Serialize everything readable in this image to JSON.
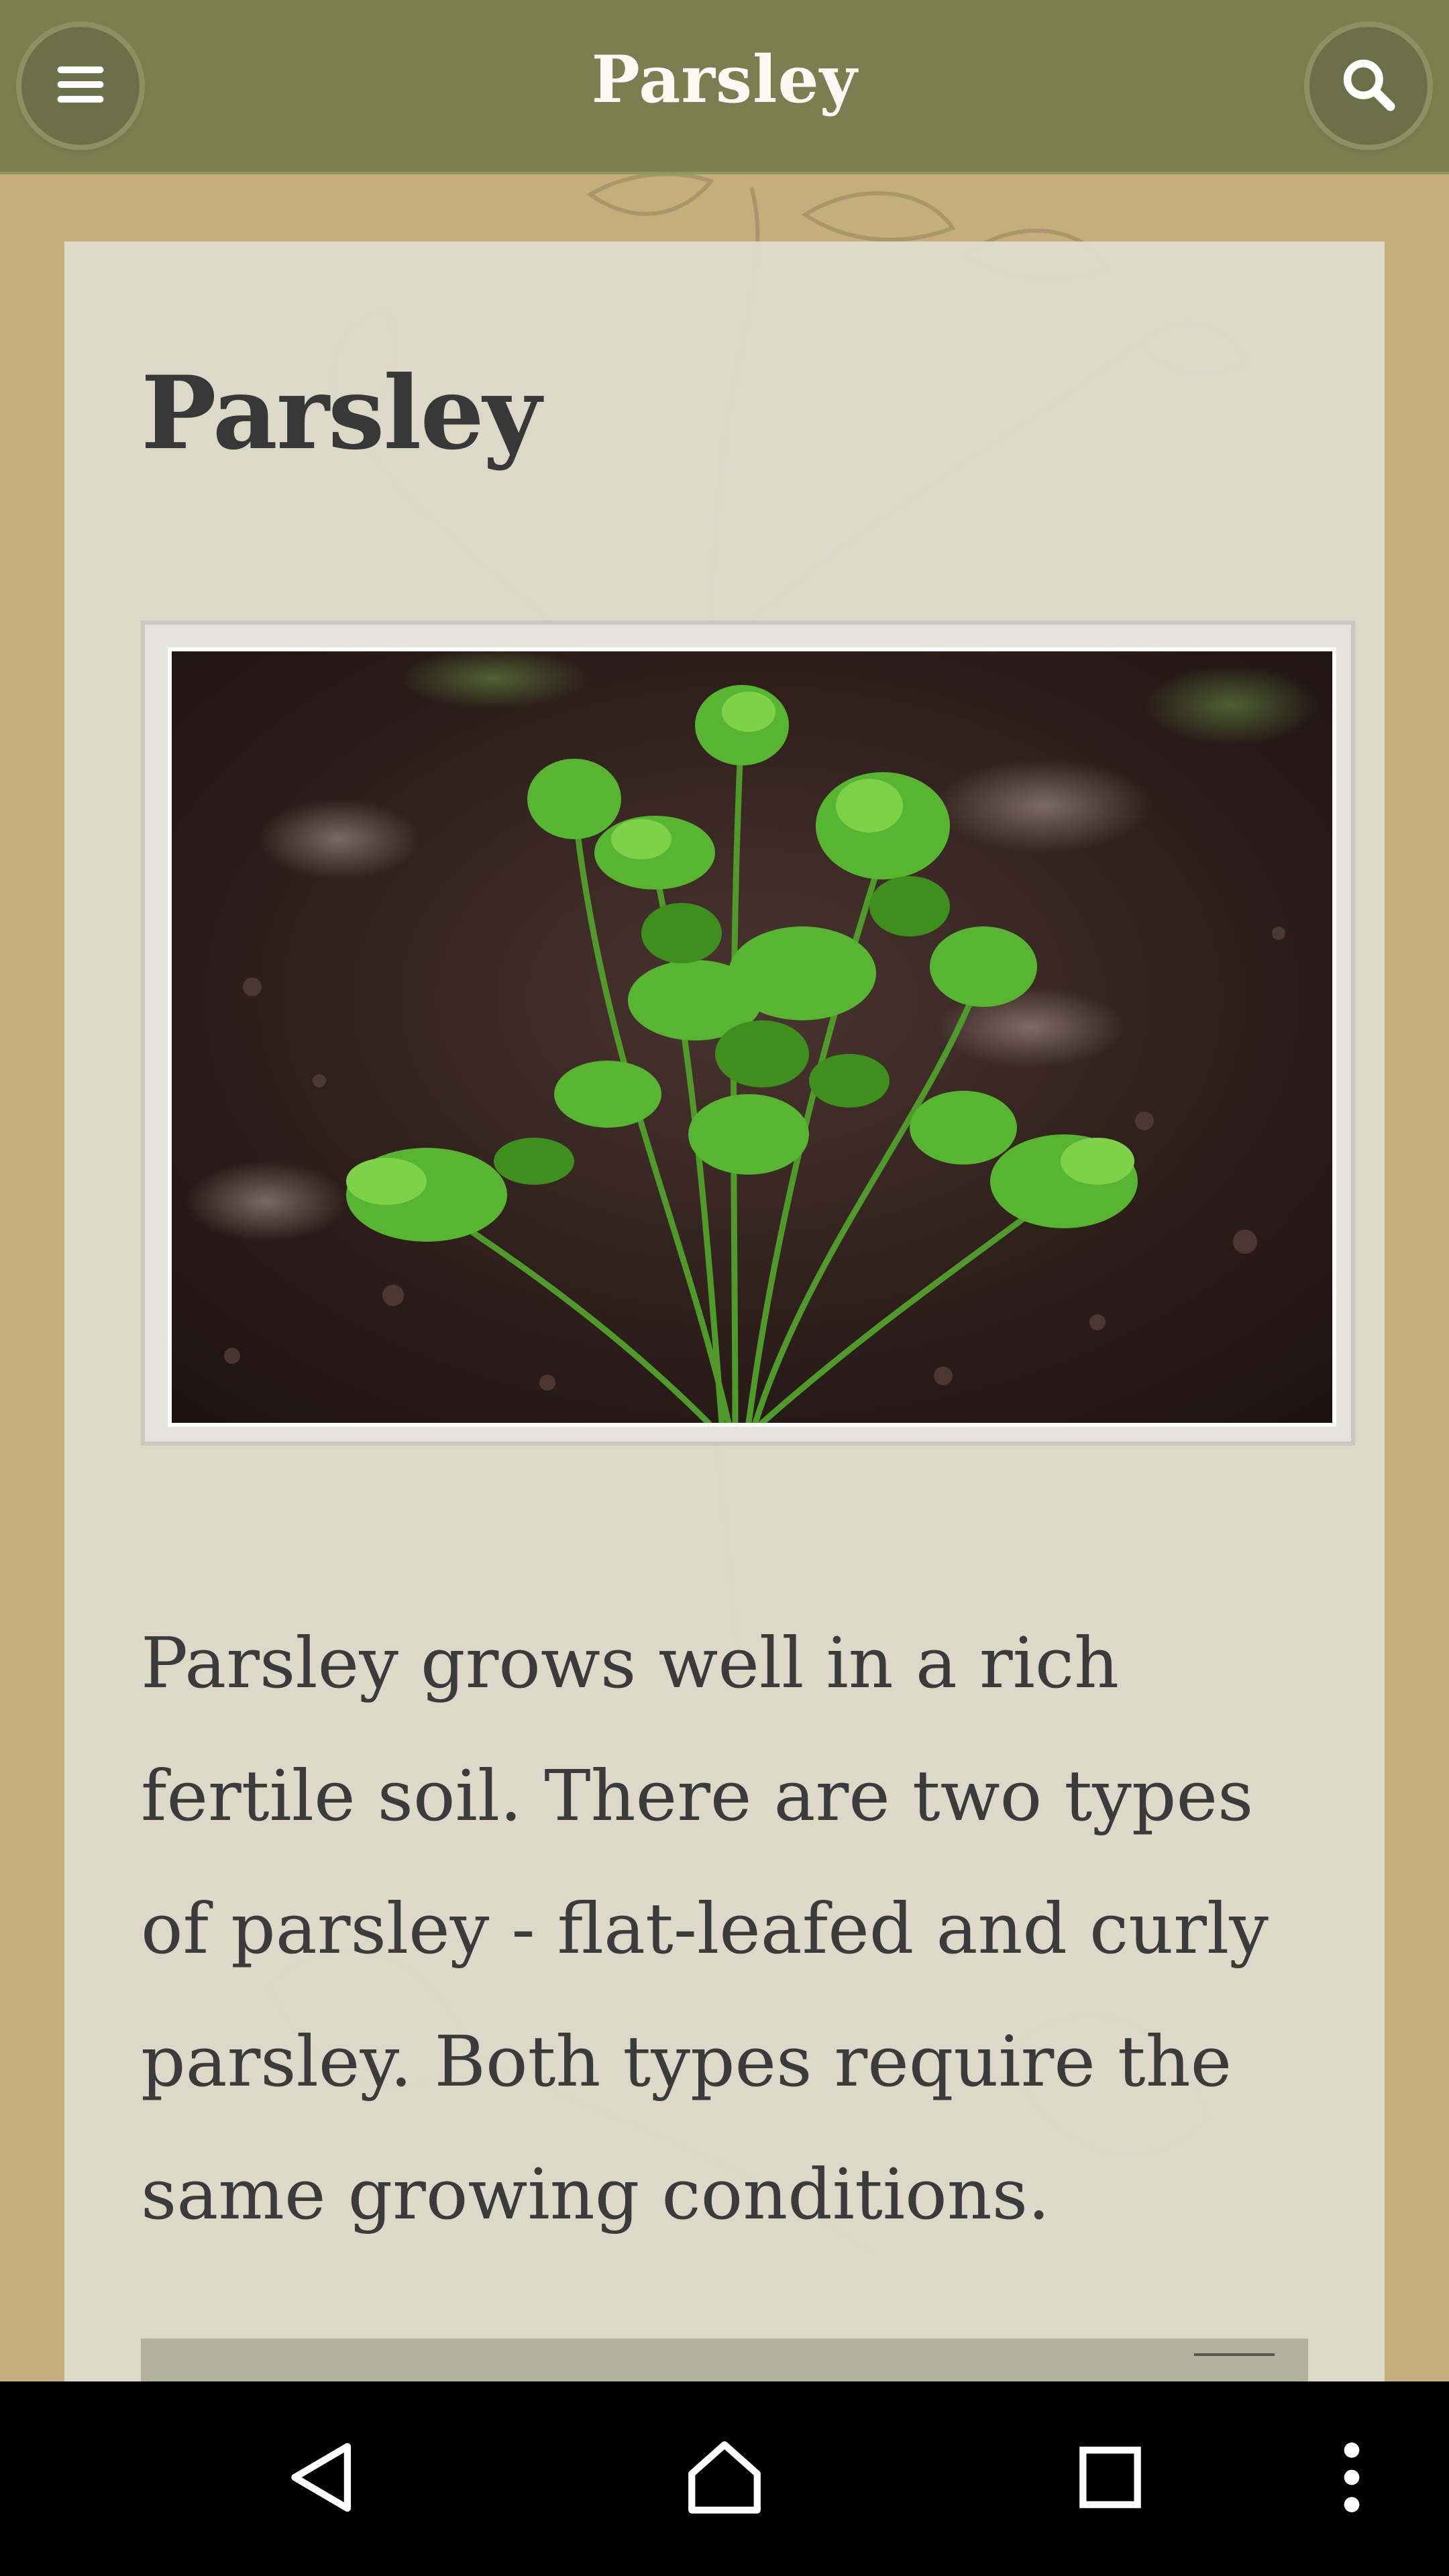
{
  "app_bar": {
    "title": "Parsley",
    "menu_icon": "menu-icon",
    "search_icon": "search-icon"
  },
  "article": {
    "title": "Parsley",
    "image_icon": "parsley-plant-photo",
    "paragraph": "Parsley grows well in a rich fertile soil. There are two types of parsley - flat-leafed and curly parsley. Both types require the same growing conditions."
  },
  "colors": {
    "app_bar": "#7a7f51",
    "page_background": "#c4ae7c",
    "card": "#dedccf",
    "text": "#3b3b3b",
    "nav_bar": "#000000"
  },
  "nav_bar": {
    "back_icon": "back-triangle-icon",
    "home_icon": "home-icon",
    "recents_icon": "recents-square-icon",
    "more_icon": "more-vertical-icon"
  }
}
